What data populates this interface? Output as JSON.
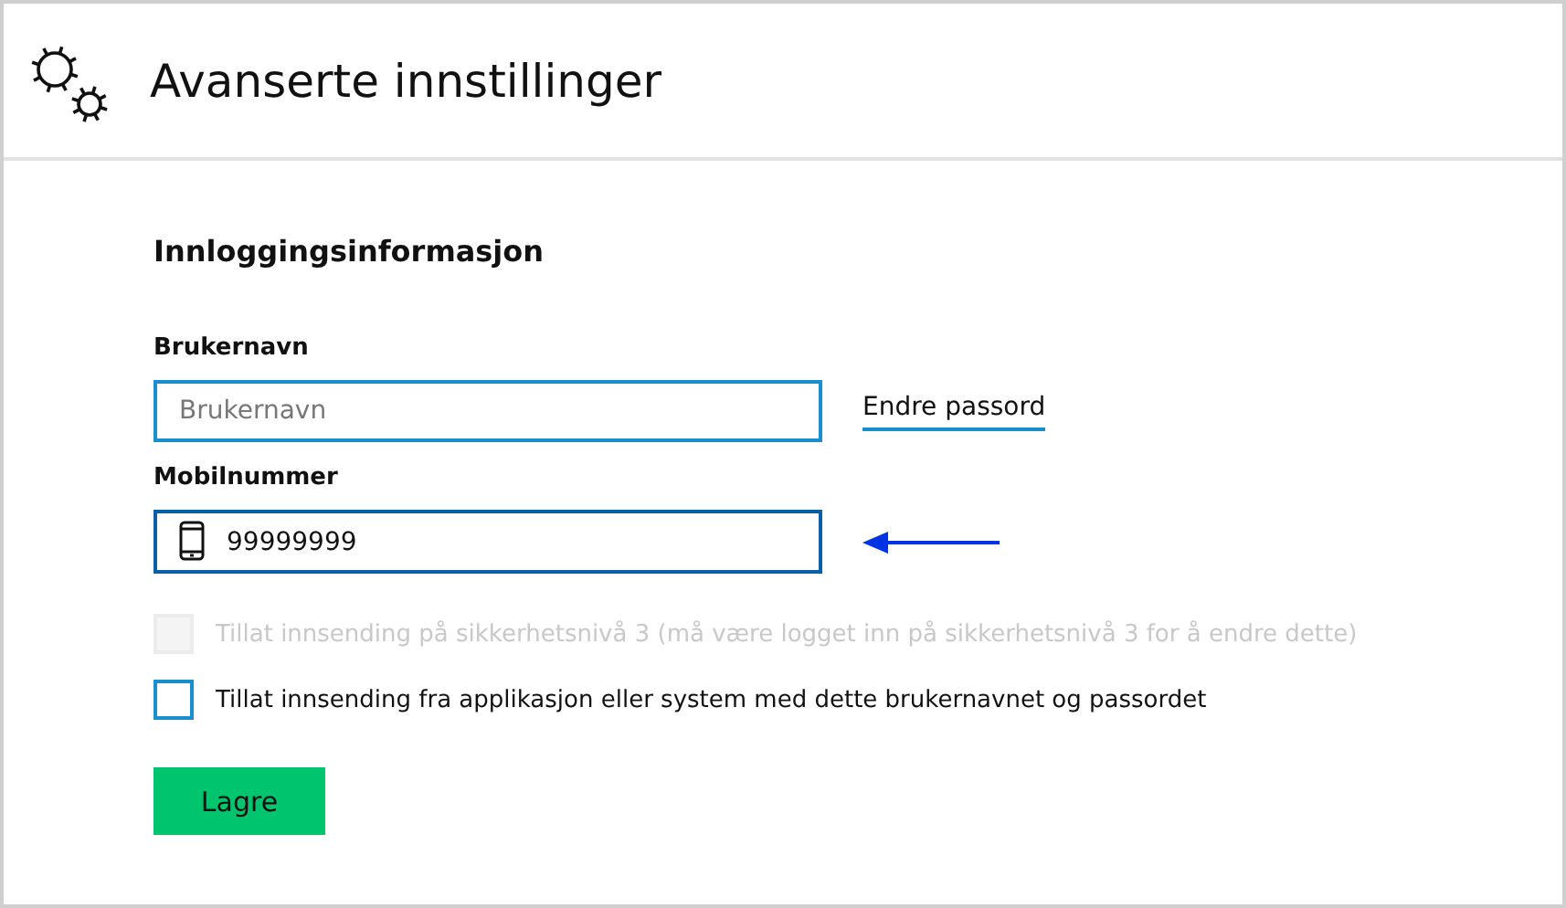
{
  "window": {
    "title": "Avanserte innstillinger"
  },
  "section": {
    "title": "Innloggingsinformasjon"
  },
  "username": {
    "label": "Brukernavn",
    "placeholder": "Brukernavn"
  },
  "change_password_link": "Endre passord",
  "mobile": {
    "label": "Mobilnummer",
    "value": "99999999"
  },
  "options": [
    {
      "label": "Tillat innsending på sikkerhetsnivå 3 (må være logget inn på sikkerhetsnivå 3 for å endre dette)",
      "checked": false,
      "disabled": true
    },
    {
      "label": "Tillat innsending fra applikasjon eller system med dette brukernavnet og passordet",
      "checked": false,
      "disabled": false
    }
  ],
  "buttons": [
    "Lagre"
  ]
}
